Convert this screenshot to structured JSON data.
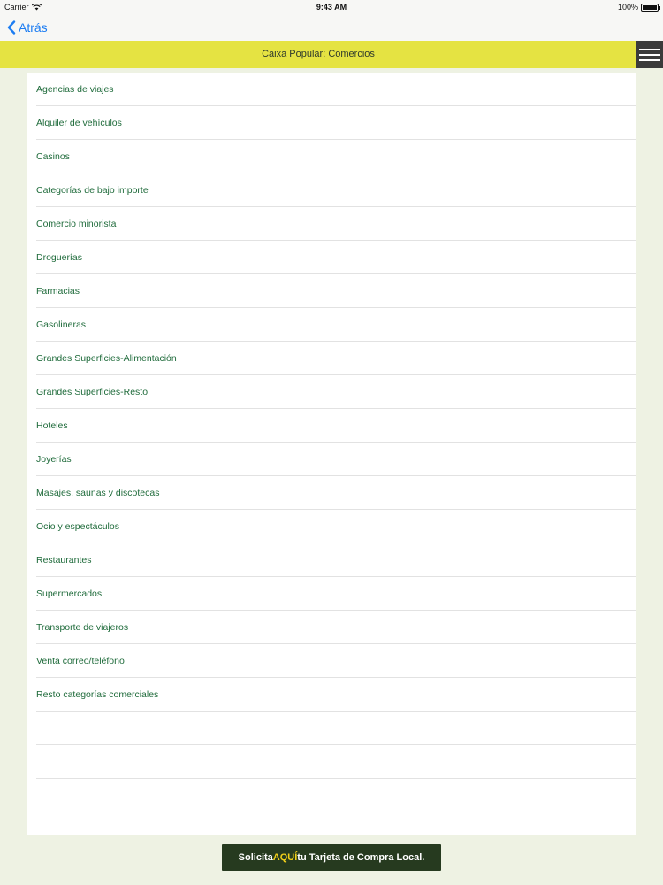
{
  "status_bar": {
    "carrier": "Carrier",
    "time": "9:43 AM",
    "battery": "100%"
  },
  "nav": {
    "back_label": "Atrás",
    "icon": "chevron-left-icon",
    "accent_color": "#1d7df2"
  },
  "header": {
    "title": "Caixa Popular: Comercios",
    "menu_icon": "hamburger-menu-icon",
    "background_color": "#e5e342"
  },
  "categories": [
    {
      "label": "Agencias de viajes"
    },
    {
      "label": "Alquiler de vehículos"
    },
    {
      "label": "Casinos"
    },
    {
      "label": "Categorías de bajo importe"
    },
    {
      "label": "Comercio minorista"
    },
    {
      "label": "Droguerías"
    },
    {
      "label": "Farmacias"
    },
    {
      "label": "Gasolineras"
    },
    {
      "label": "Grandes Superficies-Alimentación"
    },
    {
      "label": "Grandes Superficies-Resto"
    },
    {
      "label": "Hoteles"
    },
    {
      "label": "Joyerías"
    },
    {
      "label": "Masajes, saunas y discotecas"
    },
    {
      "label": "Ocio y espectáculos"
    },
    {
      "label": "Restaurantes"
    },
    {
      "label": "Supermercados"
    },
    {
      "label": "Transporte de viajeros"
    },
    {
      "label": "Venta correo/teléfono"
    },
    {
      "label": "Resto categorías comerciales"
    }
  ],
  "cta": {
    "prefix": "Solicita ",
    "highlight": "AQUÍ",
    "suffix": " tu Tarjeta de Compra Local.",
    "highlight_color": "#f2d019"
  }
}
